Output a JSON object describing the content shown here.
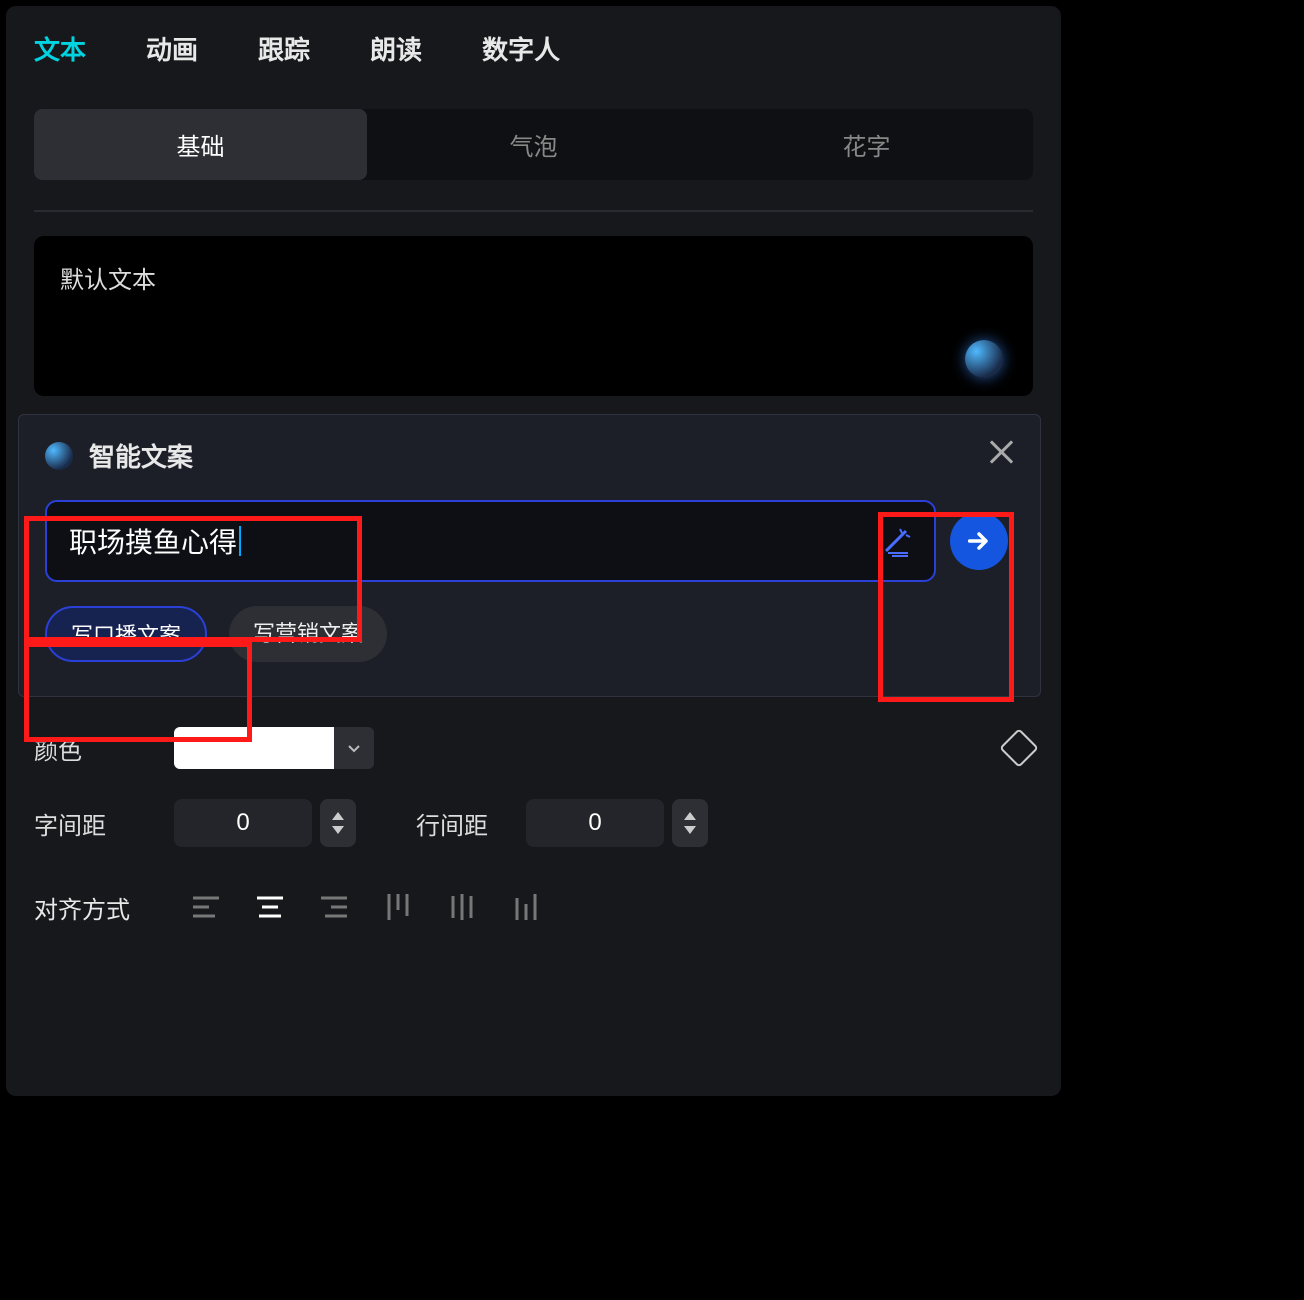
{
  "topTabs": {
    "text": "文本",
    "animation": "动画",
    "track": "跟踪",
    "read": "朗读",
    "avatar": "数字人"
  },
  "subTabs": {
    "basic": "基础",
    "bubble": "气泡",
    "fancy": "花字"
  },
  "textBox": {
    "value": "默认文本"
  },
  "ai": {
    "title": "智能文案",
    "inputValue": "职场摸鱼心得",
    "chipBroadcast": "写口播文案",
    "chipMarketing": "写营销文案"
  },
  "props": {
    "colorLabel": "颜色",
    "colorValue": "#ffffff",
    "letterSpacingLabel": "字间距",
    "letterSpacingValue": "0",
    "lineSpacingLabel": "行间距",
    "lineSpacingValue": "0",
    "alignLabel": "对齐方式"
  }
}
